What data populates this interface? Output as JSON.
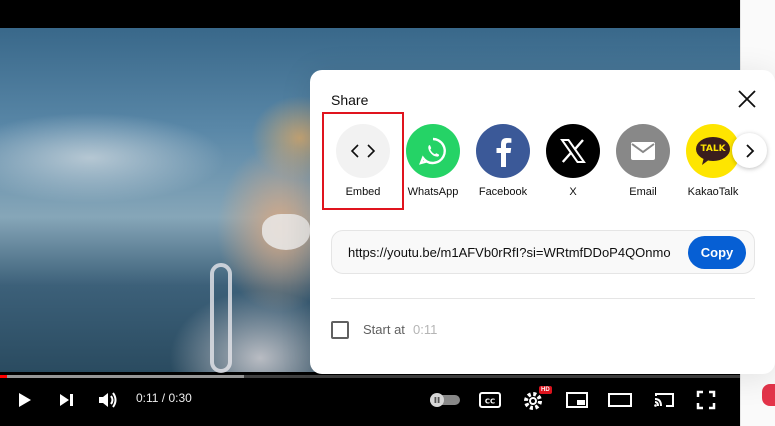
{
  "player": {
    "time_display": "0:11 / 0:30",
    "hd_badge": "HD",
    "progress_played": 0.01,
    "progress_buffered": 0.33
  },
  "share_dialog": {
    "title": "Share",
    "targets": [
      {
        "label": "Embed",
        "icon": "embed-code-icon",
        "color": "#f2f2f2"
      },
      {
        "label": "WhatsApp",
        "icon": "whatsapp-icon",
        "color": "#25d366"
      },
      {
        "label": "Facebook",
        "icon": "facebook-icon",
        "color": "#3b5998"
      },
      {
        "label": "X",
        "icon": "x-icon",
        "color": "#000000"
      },
      {
        "label": "Email",
        "icon": "email-icon",
        "color": "#888888"
      },
      {
        "label": "KakaoTalk",
        "icon": "kakaotalk-icon",
        "color": "#fee500",
        "badge_text": "TALK"
      }
    ],
    "link": {
      "url": "https://youtu.be/m1AFVb0rRfI?si=WRtmfDDoP4QOnmo",
      "copy_label": "Copy"
    },
    "start_at": {
      "label": "Start at",
      "time": "0:11"
    }
  },
  "colors": {
    "accent_blue": "#065fd4",
    "highlight_red": "#e0141e",
    "progress_red": "#ff0000"
  }
}
